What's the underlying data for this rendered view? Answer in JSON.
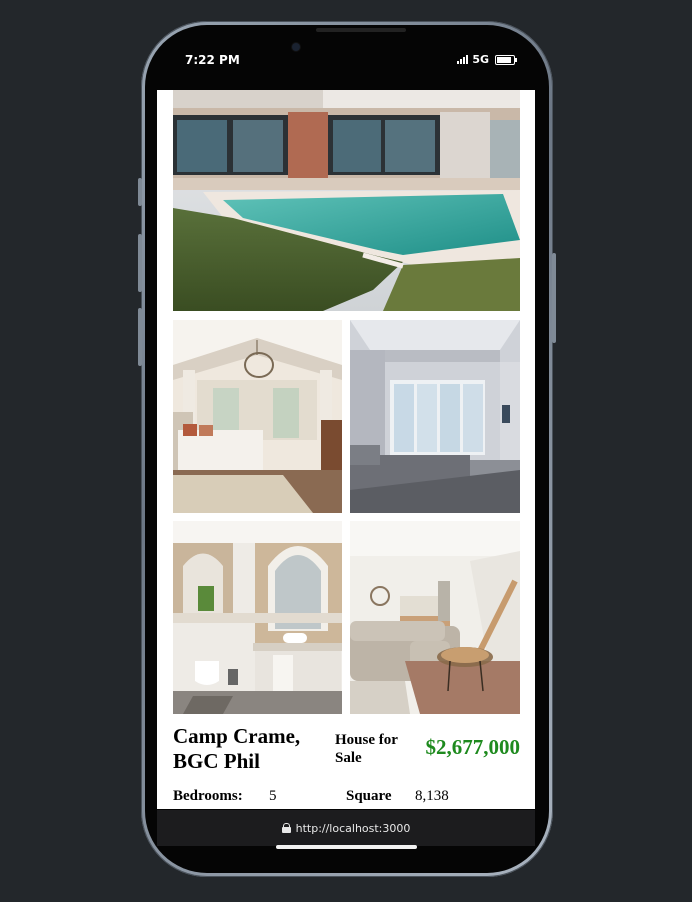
{
  "status_bar": {
    "time": "7:22 PM",
    "network": "5G"
  },
  "listing": {
    "title": "Camp Crame, BGC Phil",
    "type": "House for Sale",
    "price": "$2,677,000",
    "price_color": "#1e8a1e",
    "specs": {
      "bedrooms_label": "Bedrooms:",
      "bedrooms_value": "5",
      "square_label": "Square",
      "square_value": "8,138"
    }
  },
  "photos": [
    {
      "name": "pool-exterior",
      "icon": "pool-photo"
    },
    {
      "name": "master-bedroom",
      "icon": "bedroom-photo"
    },
    {
      "name": "modern-bedroom",
      "icon": "bedroom-photo"
    },
    {
      "name": "bathroom",
      "icon": "bathroom-photo"
    },
    {
      "name": "living-room",
      "icon": "living-room-photo"
    }
  ],
  "browser": {
    "url": "http://localhost:3000"
  }
}
